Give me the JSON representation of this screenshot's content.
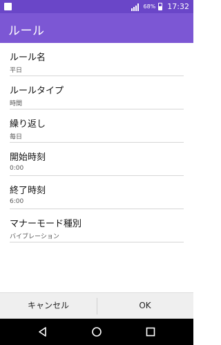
{
  "status": {
    "battery": "68%",
    "time": "17:32",
    "icons": [
      "notification-icon",
      "signal-icon",
      "battery-icon"
    ]
  },
  "app_bar": {
    "title": "ルール"
  },
  "rules": [
    {
      "label": "ルール名",
      "value": "平日"
    },
    {
      "label": "ルールタイプ",
      "value": "時間"
    },
    {
      "label": "繰り返し",
      "value": "毎日"
    },
    {
      "label": "開始時刻",
      "value": "0:00"
    },
    {
      "label": "終了時刻",
      "value": "6:00"
    },
    {
      "label": "マナーモード種別",
      "value": "バイブレーション"
    }
  ],
  "buttons": {
    "cancel": "キャンセル",
    "ok": "OK"
  },
  "nav": {
    "icons": [
      "back-icon",
      "home-icon",
      "recents-icon"
    ]
  },
  "colors": {
    "status_bar": "#6a46c8",
    "app_bar": "#7c57d4",
    "button_bar": "#efefef"
  }
}
